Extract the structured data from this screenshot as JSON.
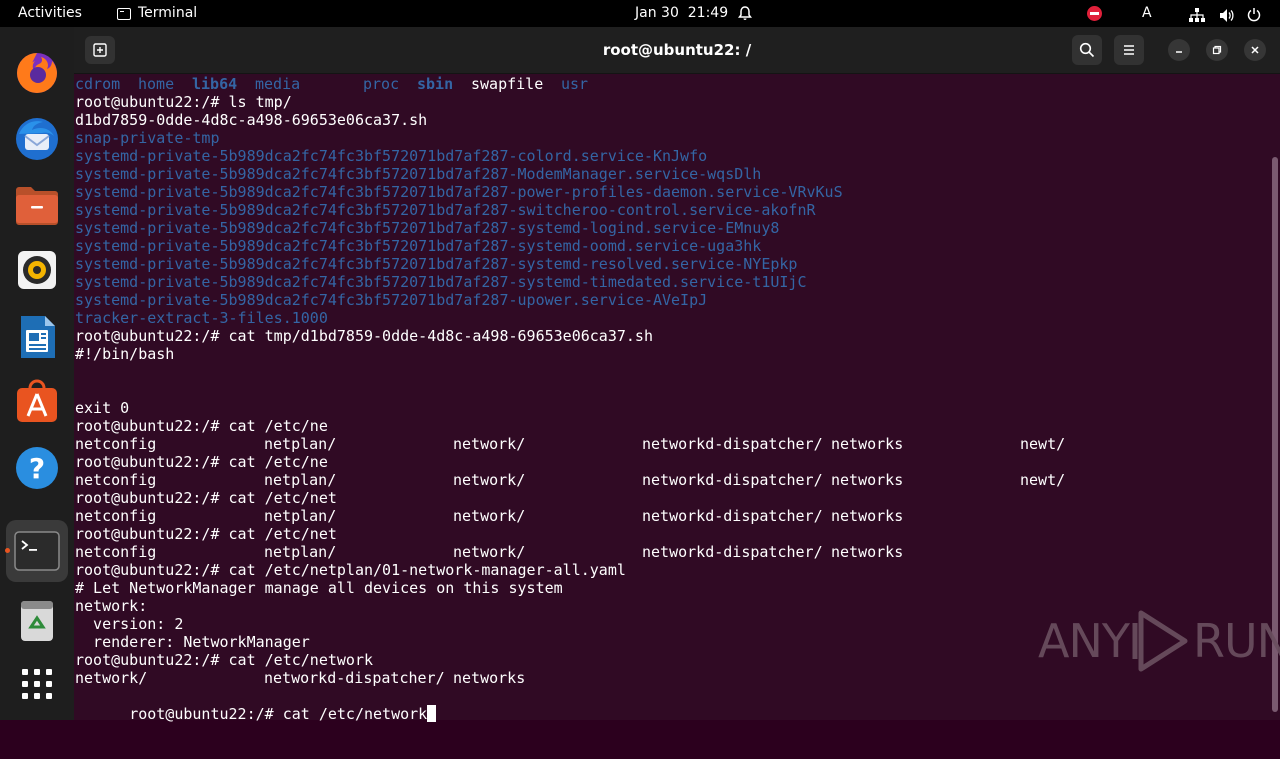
{
  "topbar": {
    "activities": "Activities",
    "app_name": "Terminal",
    "date": "Jan 30",
    "time": "21:49",
    "lang": "A"
  },
  "dock": {
    "items": [
      "firefox-icon",
      "thunderbird-icon",
      "files-icon",
      "rhythmbox-icon",
      "writer-icon",
      "software-icon",
      "help-icon",
      "terminal-icon",
      "trash-icon",
      "apps-grid-icon"
    ]
  },
  "window": {
    "title": "root@ubuntu22: /"
  },
  "terminal": {
    "dir_listing": {
      "cdrom": "cdrom",
      "home": "home",
      "lib64": "lib64",
      "media": "media",
      "proc": "proc",
      "sbin": "sbin",
      "swapfile": "swapfile",
      "usr": "usr"
    },
    "lines": [
      {
        "text": "root@ubuntu22:/# ls tmp/",
        "style": "normal"
      },
      {
        "text": "d1bd7859-0dde-4d8c-a498-69653e06ca37.sh",
        "style": "normal"
      },
      {
        "text": "snap-private-tmp",
        "style": "blue"
      },
      {
        "text": "systemd-private-5b989dca2fc74fc3bf572071bd7af287-colord.service-KnJwfo",
        "style": "blue"
      },
      {
        "text": "systemd-private-5b989dca2fc74fc3bf572071bd7af287-ModemManager.service-wqsDlh",
        "style": "blue"
      },
      {
        "text": "systemd-private-5b989dca2fc74fc3bf572071bd7af287-power-profiles-daemon.service-VRvKuS",
        "style": "blue"
      },
      {
        "text": "systemd-private-5b989dca2fc74fc3bf572071bd7af287-switcheroo-control.service-akofnR",
        "style": "blue"
      },
      {
        "text": "systemd-private-5b989dca2fc74fc3bf572071bd7af287-systemd-logind.service-EMnuy8",
        "style": "blue"
      },
      {
        "text": "systemd-private-5b989dca2fc74fc3bf572071bd7af287-systemd-oomd.service-uga3hk",
        "style": "blue"
      },
      {
        "text": "systemd-private-5b989dca2fc74fc3bf572071bd7af287-systemd-resolved.service-NYEpkp",
        "style": "blue"
      },
      {
        "text": "systemd-private-5b989dca2fc74fc3bf572071bd7af287-systemd-timedated.service-t1UIjC",
        "style": "blue"
      },
      {
        "text": "systemd-private-5b989dca2fc74fc3bf572071bd7af287-upower.service-AVeIpJ",
        "style": "blue"
      },
      {
        "text": "tracker-extract-3-files.1000",
        "style": "blue"
      },
      {
        "text": "root@ubuntu22:/# cat tmp/d1bd7859-0dde-4d8c-a498-69653e06ca37.sh",
        "style": "normal"
      },
      {
        "text": "#!/bin/bash",
        "style": "normal"
      },
      {
        "text": "",
        "style": "normal"
      },
      {
        "text": "",
        "style": "normal"
      },
      {
        "text": "exit 0",
        "style": "normal"
      },
      {
        "text": "root@ubuntu22:/# cat /etc/ne",
        "style": "normal"
      }
    ],
    "completion_rows": [
      [
        "netconfig",
        "netplan/",
        "network/",
        "networkd-dispatcher/",
        "networks",
        "newt/"
      ],
      [
        "netconfig",
        "netplan/",
        "network/",
        "networkd-dispatcher/",
        "networks",
        ""
      ],
      [
        "netconfig",
        "netplan/",
        "network/",
        "networkd-dispatcher/",
        "networks",
        ""
      ]
    ],
    "prompt_ne_2": "root@ubuntu22:/# cat /etc/ne",
    "prompt_net_1": "root@ubuntu22:/# cat /etc/net",
    "prompt_net_2": "root@ubuntu22:/# cat /etc/net",
    "cat_yaml": "root@ubuntu22:/# cat /etc/netplan/01-network-manager-all.yaml",
    "yaml_lines": [
      "# Let NetworkManager manage all devices on this system",
      "network:",
      "  version: 2",
      "  renderer: NetworkManager"
    ],
    "prompt_network": "root@ubuntu22:/# cat /etc/network",
    "network_completion": [
      "network/",
      "networkd-dispatcher/",
      "networks"
    ],
    "current_prompt": "root@ubuntu22:/# cat /etc/network"
  },
  "watermark": {
    "left": "ANY",
    "right": "RUN"
  }
}
